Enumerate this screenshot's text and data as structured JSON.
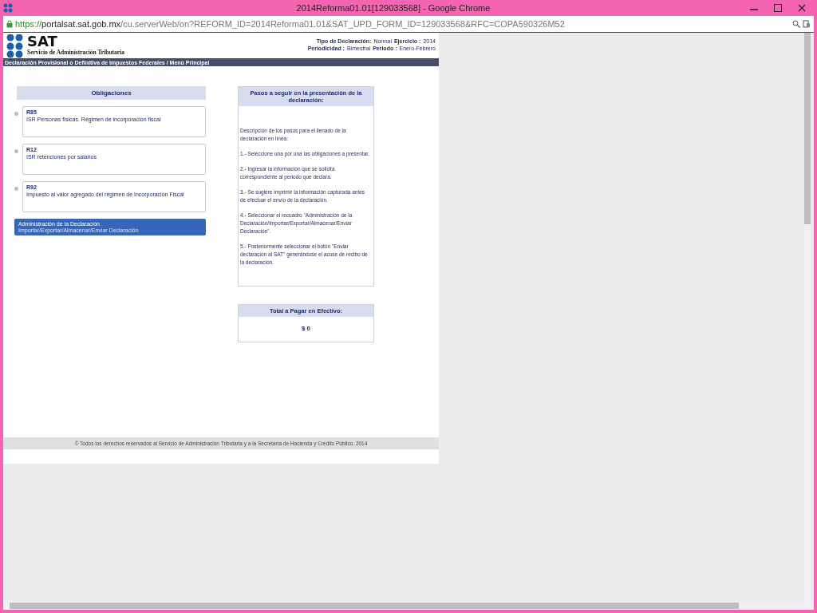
{
  "window": {
    "title": "2014Reforma01.01[129033568] - Google Chrome"
  },
  "address_bar": {
    "scheme": "https://",
    "host": "portalsat.sat.gob.mx",
    "path": "/cu.serverWeb/on?REFORM_ID=2014Reforma01.01&SAT_UPD_FORM_ID=129033568&RFC=COPA590326M52"
  },
  "header": {
    "logo_text": "SAT",
    "logo_subtitle": "Servicio de Administración Tributaria",
    "info": [
      [
        {
          "label": "Tipo de Declaración:",
          "value": "Normal"
        },
        {
          "label": "Ejercicio :",
          "value": "2014"
        }
      ],
      [
        {
          "label": "Periodicidad :",
          "value": "Bimestral"
        },
        {
          "label": "Periodo :",
          "value": "Enero-Febrero"
        }
      ]
    ]
  },
  "nav_bar": {
    "title": "Declaración Provisional o Definitiva de Impuestos Federales / Menú Principal"
  },
  "obligations": {
    "title": "Obligaciones",
    "items": [
      {
        "code": "R85",
        "description": "ISR Personas físicas. Régimen de incorporación fiscal"
      },
      {
        "code": "R12",
        "description": "ISR retenciones por salarios"
      },
      {
        "code": "R92",
        "description": "Impuesto al valor agregado del régimen de Incorporación Fiscal"
      }
    ],
    "admin": {
      "title": "Administración de la Declaración",
      "subtitle": "Importar/Exportar/Almacenar/Enviar Declaración"
    }
  },
  "steps": {
    "title": "Pasos a seguir en la presentación de la declaración:",
    "paragraphs": [
      "Descripción de los pasos para el llenado de la declaración en línea:",
      "1.- Seleccione una por una las obligaciones a presentar.",
      "2.- Ingresar la información que se solicita correspondiente al periodo que declara.",
      "3.- Se sugiere imprimir la información capturada antes de efectuar el envío de la declaración.",
      "4.- Seleccionar el recuadro \"Administración de la Declaración/Importar/Exportar/Almacenar/Enviar Declaración\".",
      "5.- Posteriormente seleccionar el botón \"Enviar declaración al SAT\" generándose el acuse de recibo de la declaración."
    ]
  },
  "total": {
    "title": "Total a Pagar en Efectivo:",
    "amount": "$ 0"
  },
  "footer": {
    "text": "© Todos los derechos reservados al Servicio de Administración Tributaria y a la Secretaría de Hacienda y Crédito Público. 2014"
  }
}
